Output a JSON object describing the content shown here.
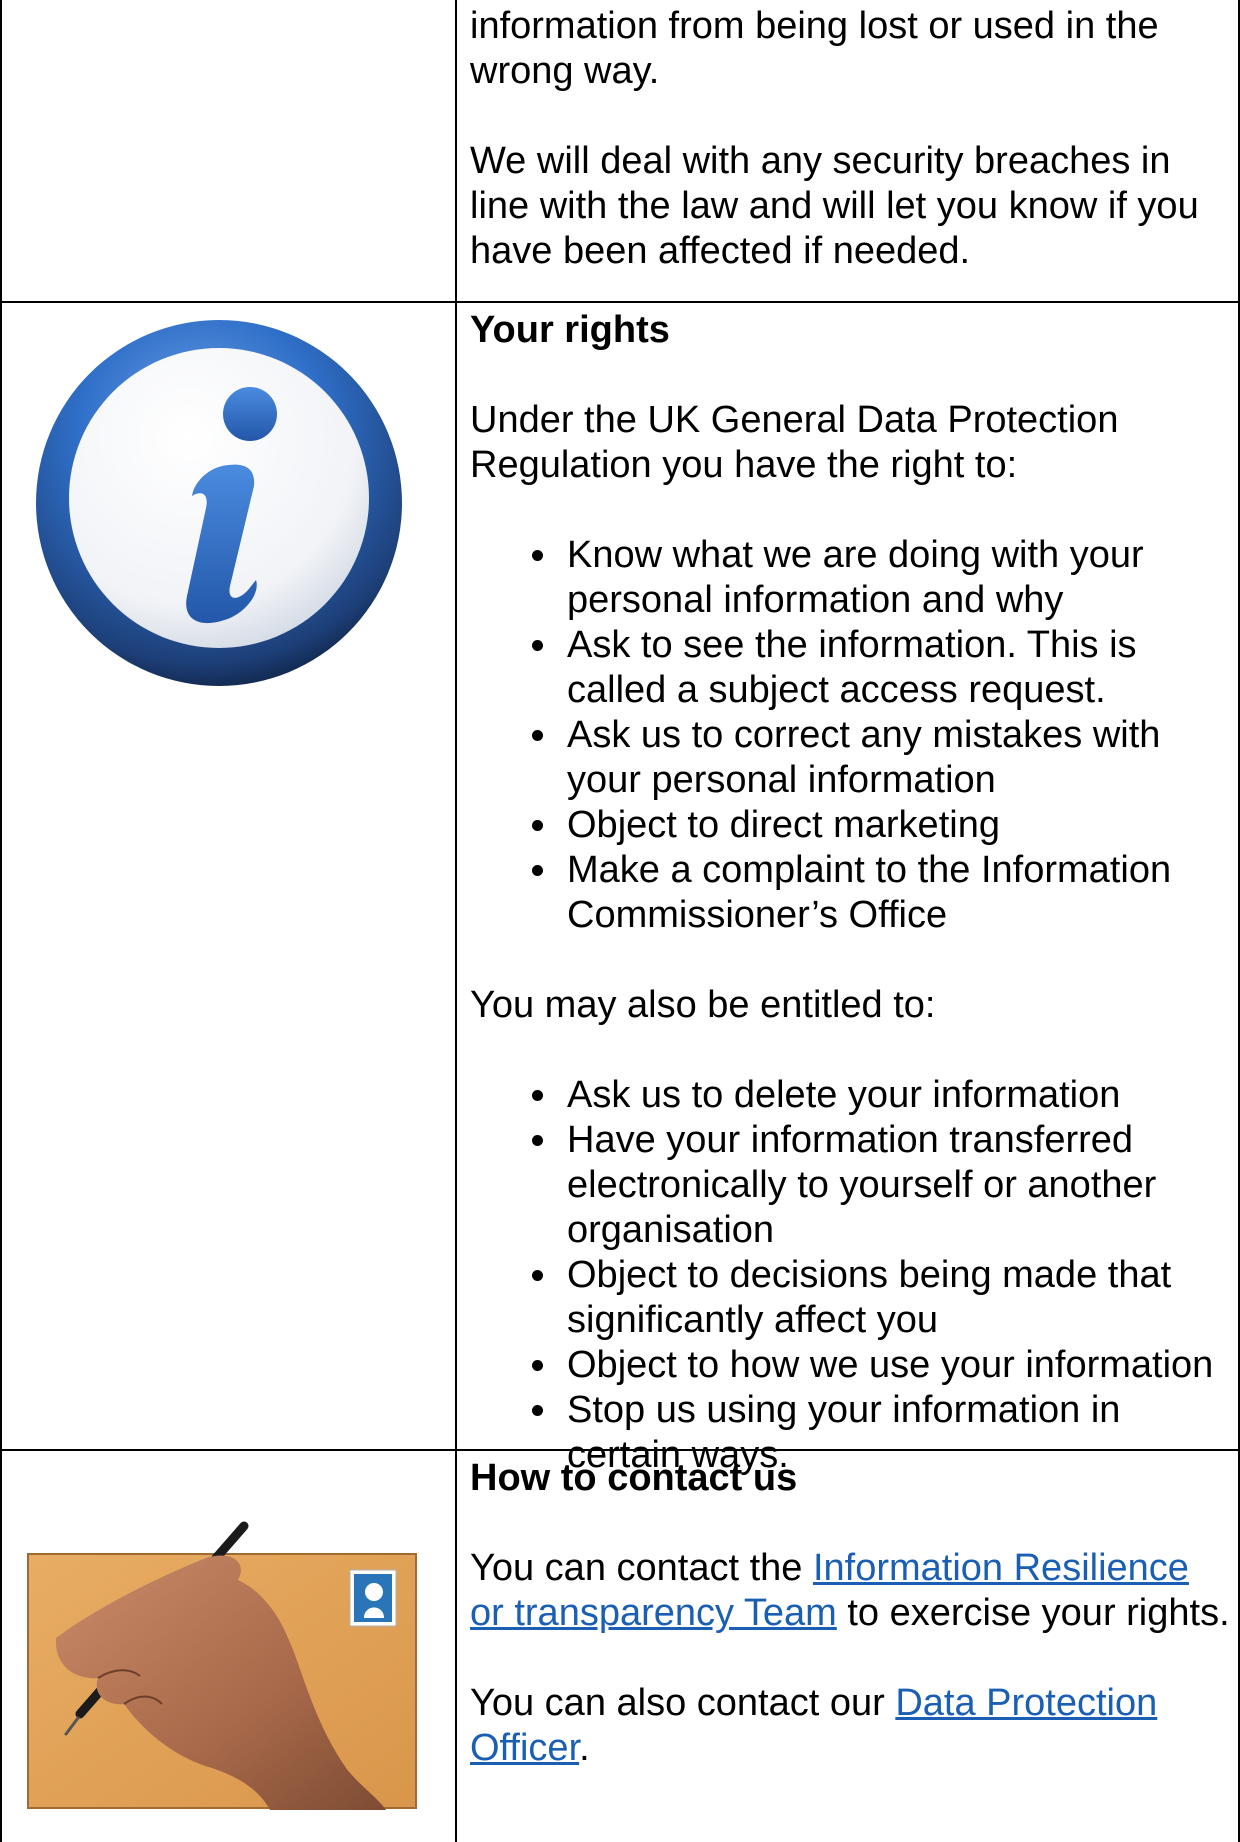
{
  "row1": {
    "line1": "information from being lost or used in the",
    "line2": "wrong way.",
    "para2": "We will deal with any security breaches in line with the law and will let you know if you have been affected if needed."
  },
  "rights": {
    "icon": "information-icon",
    "heading": "Your rights",
    "intro": "Under the UK General Data Protection Regulation you have the right to:",
    "rights_list": [
      "Know what we are doing with your personal information and why",
      "Ask to see the information. This is called a subject access request.",
      "Ask us to correct any mistakes with your personal information",
      "Object to direct marketing",
      "Make a complaint to the Information Commissioner’s Office"
    ],
    "also": "You may also be entitled to:",
    "entitled_list": [
      "Ask us to delete your information",
      "Have your information transferred electronically to yourself or another organisation",
      "Object to decisions being made that significantly affect you",
      "Object to how we use your information",
      "Stop us using your information in certain ways."
    ]
  },
  "contact": {
    "icon": "hand-writing-envelope-image",
    "heading": "How to contact us",
    "p1_pre": "You can contact the ",
    "p1_link": "Information Resilience or transparency Team",
    "p1_post": " to exercise your rights.",
    "p2_pre": "You can also contact our ",
    "p2_link": "Data Protection Officer",
    "p2_post": "."
  },
  "colors": {
    "link": "#1a5fb4",
    "icon_blue": "#2f6fc8",
    "envelope": "#e2a35a"
  }
}
